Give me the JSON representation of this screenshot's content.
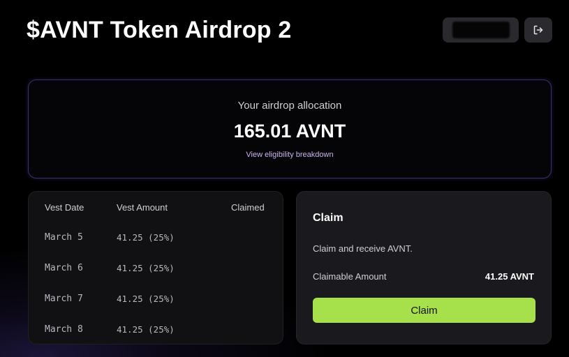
{
  "header": {
    "title": "$AVNT Token Airdrop 2",
    "wallet_label": "",
    "logout_icon": "logout-icon"
  },
  "allocation": {
    "label": "Your airdrop allocation",
    "amount": "165.01 AVNT",
    "link": "View eligibility breakdown"
  },
  "vesting": {
    "headers": [
      "Vest Date",
      "Vest Amount",
      "Claimed"
    ],
    "rows": [
      {
        "date": "March 5",
        "amount": "41.25 (25%)",
        "claimed": ""
      },
      {
        "date": "March 6",
        "amount": "41.25 (25%)",
        "claimed": ""
      },
      {
        "date": "March 7",
        "amount": "41.25 (25%)",
        "claimed": ""
      },
      {
        "date": "March 8",
        "amount": "41.25 (25%)",
        "claimed": ""
      }
    ]
  },
  "claim": {
    "title": "Claim",
    "description": "Claim and receive AVNT.",
    "claimable_label": "Claimable Amount",
    "claimable_value": "41.25 AVNT",
    "button_label": "Claim"
  },
  "colors": {
    "accent": "#a6e04b",
    "border_purple": "#3d2f6e",
    "link": "#c9b6f5"
  }
}
